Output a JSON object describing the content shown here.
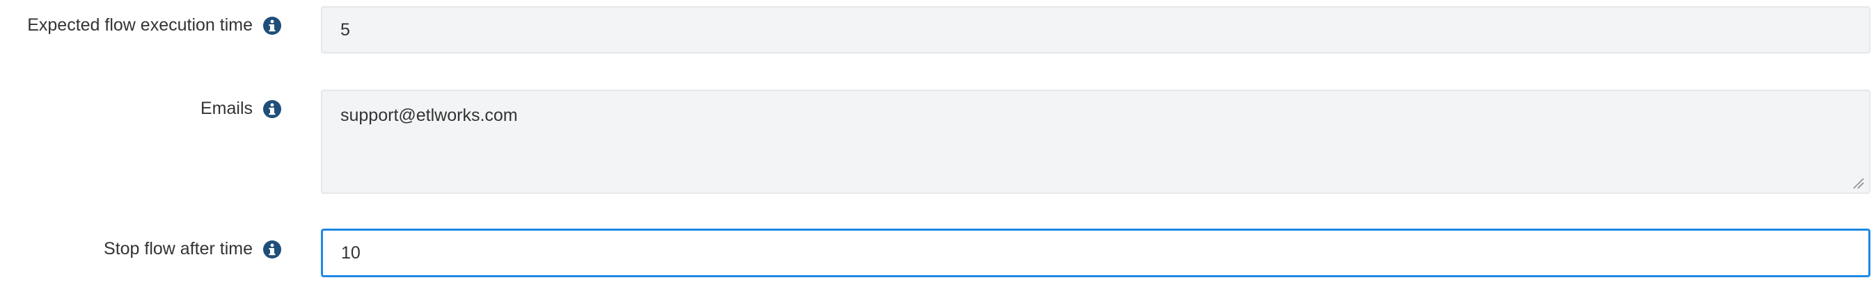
{
  "form": {
    "fields": [
      {
        "label": "Expected flow execution time",
        "value": "5",
        "type": "input",
        "focused": false,
        "info_icon": "info-circle-icon"
      },
      {
        "label": "Emails",
        "value": "support@etlworks.com",
        "type": "textarea",
        "focused": false,
        "info_icon": "info-circle-icon"
      },
      {
        "label": "Stop flow after time",
        "value": "10",
        "type": "input",
        "focused": true,
        "info_icon": "info-circle-icon"
      }
    ]
  },
  "colors": {
    "icon": "#1f4e79",
    "field_bg": "#f3f4f6",
    "focus_border": "#1e88e5",
    "text": "#333333"
  }
}
